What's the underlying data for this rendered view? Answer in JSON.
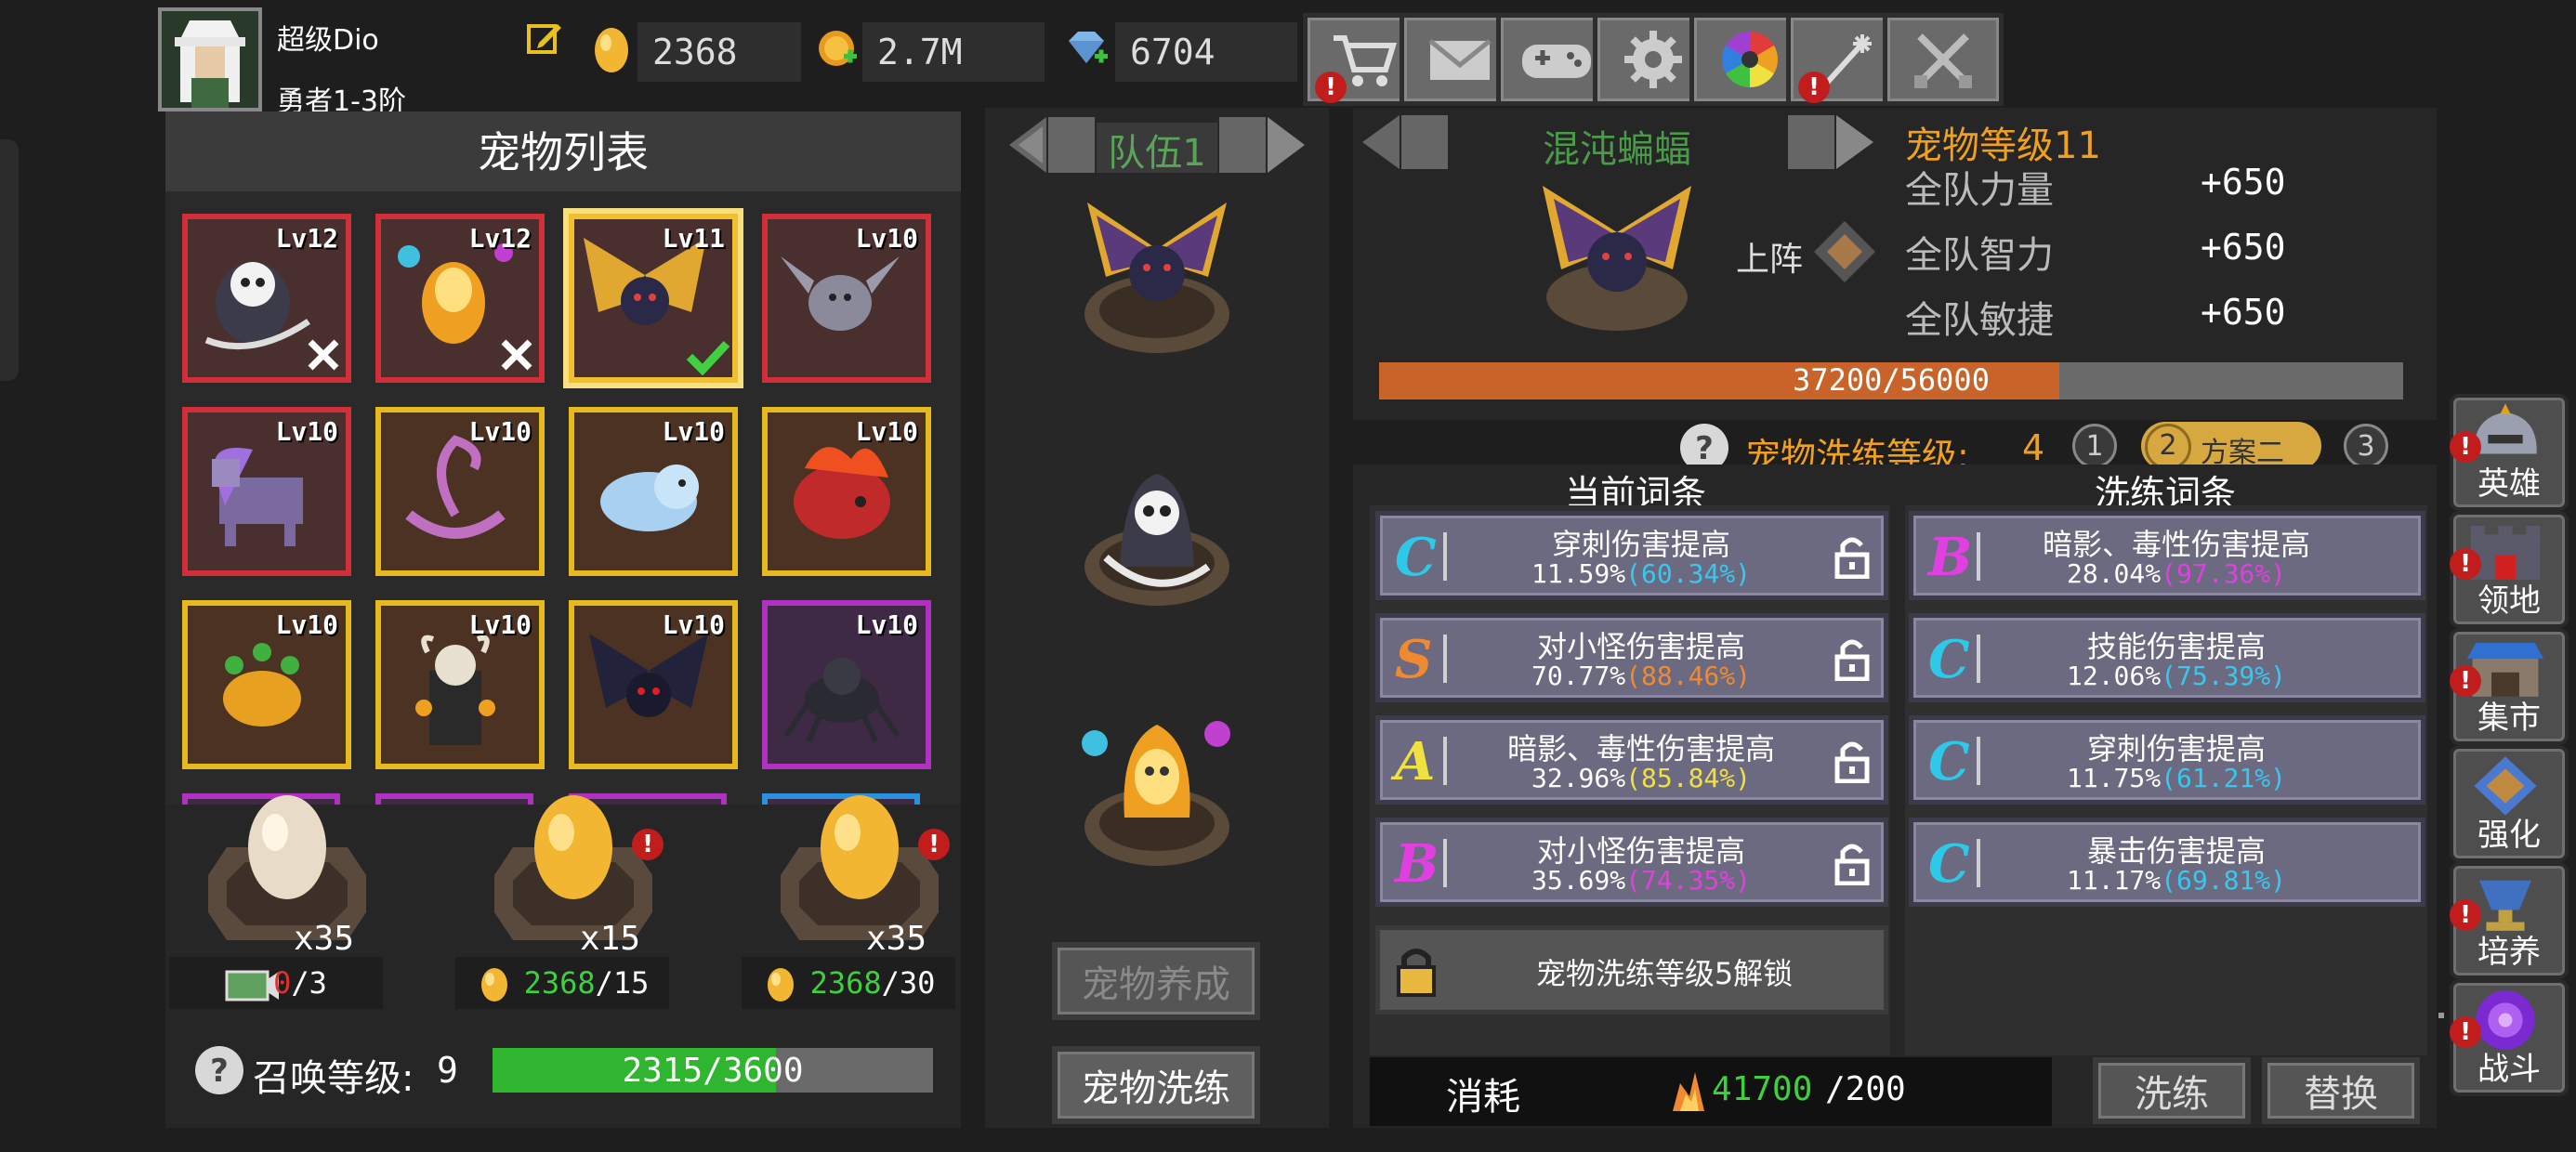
{
  "player": {
    "name": "超级Dio",
    "rank": "勇者1-3阶"
  },
  "resources": {
    "eggs": "2368",
    "gold": "2.7M",
    "gems": "6704"
  },
  "pet_list": {
    "title": "宠物列表",
    "pets": [
      {
        "level": "Lv12",
        "border": "#d0303a",
        "bg": "#4a2f2f"
      },
      {
        "level": "Lv12",
        "border": "#d0303a",
        "bg": "#4a2f2f"
      },
      {
        "level": "Lv11",
        "border": "#f0c030",
        "bg": "#4a2f2f"
      },
      {
        "level": "Lv10",
        "border": "#d0303a",
        "bg": "#4a2f2f"
      },
      {
        "level": "Lv10",
        "border": "#d0303a",
        "bg": "#4a2f2f"
      },
      {
        "level": "Lv10",
        "border": "#e8b820",
        "bg": "#4b3222"
      },
      {
        "level": "Lv10",
        "border": "#e8b820",
        "bg": "#4b3222"
      },
      {
        "level": "Lv10",
        "border": "#e8b820",
        "bg": "#4b3222"
      },
      {
        "level": "Lv10",
        "border": "#e8b820",
        "bg": "#4b3222"
      },
      {
        "level": "Lv10",
        "border": "#e8b820",
        "bg": "#4b3222"
      },
      {
        "level": "Lv10",
        "border": "#e8b820",
        "bg": "#4b3222"
      },
      {
        "level": "Lv10",
        "border": "#b030c0",
        "bg": "#3e2a45"
      }
    ]
  },
  "eggs": [
    {
      "count": "x35",
      "cost_have": "0",
      "cost_need": "/3"
    },
    {
      "count": "x15",
      "cost_have": "2368",
      "cost_need": "/15"
    },
    {
      "count": "x35",
      "cost_have": "2368",
      "cost_need": "/30"
    }
  ],
  "summon": {
    "label": "召唤等级:",
    "level": "9",
    "progress": "2315/3600",
    "fill": 0.643
  },
  "team": {
    "title": "队伍1",
    "train_btn": "宠物养成",
    "refine_btn": "宠物洗练"
  },
  "pet_detail": {
    "name": "混沌蝙蝠",
    "level_label": "宠物等级11",
    "deploy": "上阵",
    "stats": [
      {
        "name": "全队力量",
        "value": "+650"
      },
      {
        "name": "全队智力",
        "value": "+650"
      },
      {
        "name": "全队敏捷",
        "value": "+650"
      }
    ],
    "exp": "37200/56000",
    "exp_fill": 0.664
  },
  "refine": {
    "level_label": "宠物洗练等级:",
    "level": "4",
    "schemes": [
      "1",
      "2",
      "方案二",
      "3"
    ],
    "current_header": "当前词条",
    "refine_header": "洗练词条",
    "current": [
      {
        "grade": "C",
        "color": "#2ec8e8",
        "name": "穿刺伤害提高",
        "val": "11.59%",
        "pct": "(60.34%)",
        "pct_color": "#36c8f0"
      },
      {
        "grade": "S",
        "color": "#f08a30",
        "name": "对小怪伤害提高",
        "val": "70.77%",
        "pct": "(88.46%)",
        "pct_color": "#f08a30"
      },
      {
        "grade": "A",
        "color": "#f0e040",
        "name": "暗影、毒性伤害提高",
        "val": "32.96%",
        "pct": "(85.84%)",
        "pct_color": "#f0e040"
      },
      {
        "grade": "B",
        "color": "#e040e0",
        "name": "对小怪伤害提高",
        "val": "35.69%",
        "pct": "(74.35%)",
        "pct_color": "#e040e0"
      }
    ],
    "locked_text": "宠物洗练等级5解锁",
    "refined": [
      {
        "grade": "B",
        "color": "#e040e0",
        "name": "暗影、毒性伤害提高",
        "val": "28.04%",
        "pct": "(97.36%)",
        "pct_color": "#e040e0"
      },
      {
        "grade": "C",
        "color": "#2ec8e8",
        "name": "技能伤害提高",
        "val": "12.06%",
        "pct": "(75.39%)",
        "pct_color": "#36c8f0"
      },
      {
        "grade": "C",
        "color": "#2ec8e8",
        "name": "穿刺伤害提高",
        "val": "11.75%",
        "pct": "(61.21%)",
        "pct_color": "#36c8f0"
      },
      {
        "grade": "C",
        "color": "#2ec8e8",
        "name": "暴击伤害提高",
        "val": "11.17%",
        "pct": "(69.81%)",
        "pct_color": "#36c8f0"
      }
    ],
    "cost_label": "消耗",
    "cost_have": "41700",
    "cost_need": "/200",
    "refine_btn": "洗练",
    "replace_btn": "替换"
  },
  "side_menu": [
    "英雄",
    "领地",
    "集市",
    "强化",
    "培养",
    "战斗"
  ],
  "colors": {
    "accent_orange": "#f0a020",
    "title_green": "#4a9a4a",
    "exp_bar": "#c8642a",
    "summon_bar": "#2fb52f"
  }
}
